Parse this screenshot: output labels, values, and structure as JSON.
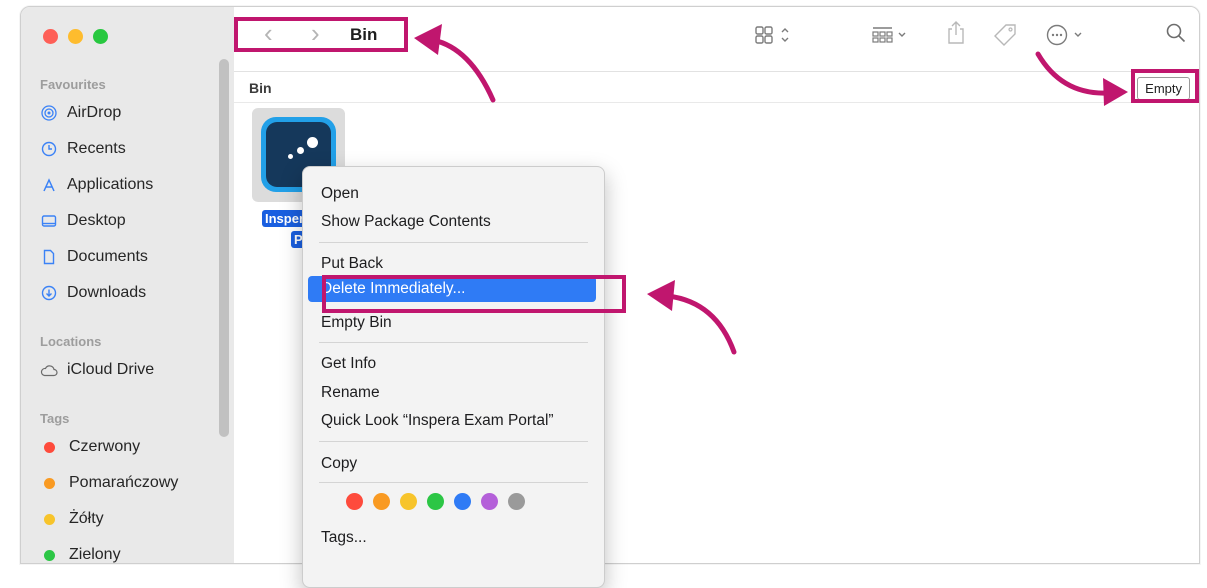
{
  "toolbar": {
    "title": "Bin",
    "back": "‹",
    "forward": "›"
  },
  "pathbar": {
    "label": "Bin",
    "empty_button": "Empty"
  },
  "sidebar": {
    "favourites_header": "Favourites",
    "favourites": [
      {
        "label": "AirDrop",
        "icon": "airdrop-icon"
      },
      {
        "label": "Recents",
        "icon": "clock-icon"
      },
      {
        "label": "Applications",
        "icon": "applications-icon"
      },
      {
        "label": "Desktop",
        "icon": "desktop-icon"
      },
      {
        "label": "Documents",
        "icon": "document-icon"
      },
      {
        "label": "Downloads",
        "icon": "download-icon"
      }
    ],
    "locations_header": "Locations",
    "locations": [
      {
        "label": "iCloud Drive",
        "icon": "cloud-icon"
      }
    ],
    "tags_header": "Tags",
    "tags": [
      {
        "label": "Czerwony",
        "color": "#fe4b3c"
      },
      {
        "label": "Pomarańczowy",
        "color": "#f99a22"
      },
      {
        "label": "Żółty",
        "color": "#f7c42b"
      },
      {
        "label": "Zielony",
        "color": "#2cc645"
      }
    ]
  },
  "file": {
    "label_line1": "Inspera",
    "label_line2": "Por"
  },
  "context_menu": {
    "open": "Open",
    "show_package": "Show Package Contents",
    "put_back": "Put Back",
    "delete_immediately": "Delete Immediately...",
    "empty_bin": "Empty Bin",
    "get_info": "Get Info",
    "rename": "Rename",
    "quick_look": "Quick Look “Inspera Exam Portal”",
    "copy": "Copy",
    "tags": "Tags...",
    "tag_colors": [
      "#fe4b3c",
      "#f99a22",
      "#f7c42b",
      "#2cc645",
      "#2f7bf5",
      "#b460d9",
      "#9a9a9a"
    ]
  },
  "colors": {
    "highlight": "#c0166e",
    "selection": "#2f7bf5"
  }
}
